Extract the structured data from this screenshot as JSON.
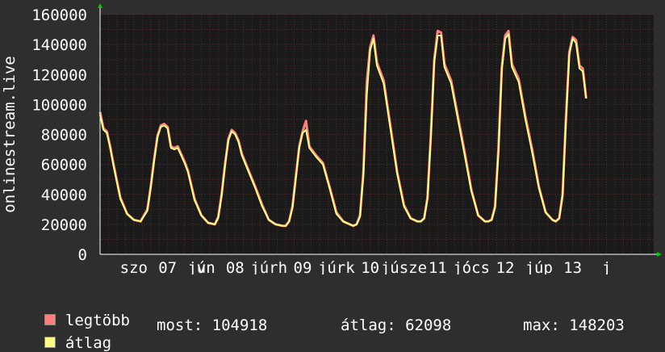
{
  "chart_data": {
    "type": "area",
    "ylabel": "onlinestream.live",
    "ylim": [
      0,
      160000
    ],
    "y_ticks": [
      {
        "value": 0,
        "label": "0"
      },
      {
        "value": 20000,
        "label": "20000"
      },
      {
        "value": 40000,
        "label": "40000"
      },
      {
        "value": 60000,
        "label": "60000"
      },
      {
        "value": 80000,
        "label": "80000"
      },
      {
        "value": 100000,
        "label": "100000"
      },
      {
        "value": 120000,
        "label": "120000"
      },
      {
        "value": 140000,
        "label": "140000"
      },
      {
        "value": 160000,
        "label": "160000"
      }
    ],
    "xlim": [
      0,
      8.2
    ],
    "x_ticks": [
      {
        "x": 0.5,
        "label": "szo"
      },
      {
        "x": 1.0,
        "label": "07"
      },
      {
        "x": 1.5,
        "label": "jún"
      },
      {
        "x": 1.5,
        "label": "v"
      },
      {
        "x": 2.0,
        "label": "08"
      },
      {
        "x": 2.5,
        "label": "júrh"
      },
      {
        "x": 3.0,
        "label": "09"
      },
      {
        "x": 3.5,
        "label": "júrk"
      },
      {
        "x": 4.0,
        "label": "10"
      },
      {
        "x": 4.5,
        "label": "júsze"
      },
      {
        "x": 5.0,
        "label": "11"
      },
      {
        "x": 5.5,
        "label": "jócs"
      },
      {
        "x": 6.0,
        "label": "12"
      },
      {
        "x": 6.5,
        "label": "júp"
      },
      {
        "x": 7.0,
        "label": "13"
      },
      {
        "x": 7.5,
        "label": "j"
      }
    ],
    "series": [
      {
        "name": "legtöbb",
        "color": "#ff7f7f",
        "x": [
          0.0,
          0.05,
          0.1,
          0.15,
          0.2,
          0.3,
          0.4,
          0.5,
          0.6,
          0.7,
          0.75,
          0.8,
          0.85,
          0.9,
          0.95,
          1.0,
          1.05,
          1.1,
          1.15,
          1.2,
          1.25,
          1.3,
          1.4,
          1.5,
          1.6,
          1.7,
          1.75,
          1.8,
          1.85,
          1.9,
          1.95,
          2.0,
          2.05,
          2.1,
          2.2,
          2.3,
          2.4,
          2.5,
          2.6,
          2.7,
          2.75,
          2.8,
          2.85,
          2.9,
          2.95,
          3.0,
          3.05,
          3.1,
          3.2,
          3.3,
          3.4,
          3.5,
          3.6,
          3.7,
          3.75,
          3.8,
          3.85,
          3.9,
          3.95,
          4.0,
          4.05,
          4.1,
          4.2,
          4.3,
          4.4,
          4.5,
          4.6,
          4.7,
          4.75,
          4.8,
          4.85,
          4.9,
          4.95,
          5.0,
          5.05,
          5.1,
          5.2,
          5.3,
          5.4,
          5.5,
          5.6,
          5.7,
          5.75,
          5.8,
          5.85,
          5.9,
          5.95,
          6.0,
          6.05,
          6.1,
          6.2,
          6.3,
          6.4,
          6.5,
          6.6,
          6.7,
          6.75,
          6.8,
          6.85,
          6.9,
          6.95,
          7.0,
          7.05,
          7.1,
          7.15,
          7.2
        ],
        "values": [
          95000,
          84000,
          82000,
          72000,
          60000,
          38000,
          27000,
          23000,
          22000,
          30000,
          45000,
          63000,
          79000,
          86000,
          87000,
          85000,
          72000,
          71000,
          72000,
          67000,
          62000,
          56000,
          37000,
          26000,
          21000,
          20000,
          25000,
          40000,
          60000,
          77000,
          83000,
          81000,
          76000,
          67000,
          56000,
          45000,
          33000,
          23000,
          20000,
          19000,
          19000,
          22000,
          32000,
          52000,
          72000,
          82000,
          89000,
          72000,
          66000,
          61000,
          45000,
          28000,
          22000,
          20000,
          19000,
          20000,
          26000,
          55000,
          115000,
          138000,
          146000,
          128000,
          116000,
          86000,
          55000,
          33000,
          24000,
          22000,
          22000,
          24000,
          38000,
          80000,
          130000,
          149000,
          148000,
          127000,
          116000,
          92000,
          68000,
          43000,
          26000,
          22000,
          22000,
          23000,
          32000,
          70000,
          125000,
          146000,
          149000,
          127000,
          117000,
          92000,
          70000,
          45000,
          28000,
          23000,
          22000,
          24000,
          40000,
          90000,
          135000,
          145000,
          143000,
          126000,
          124000,
          104000
        ]
      },
      {
        "name": "átlag",
        "color": "#ffff7f",
        "x": [
          0.0,
          0.05,
          0.1,
          0.15,
          0.2,
          0.3,
          0.4,
          0.5,
          0.6,
          0.7,
          0.75,
          0.8,
          0.85,
          0.9,
          0.95,
          1.0,
          1.05,
          1.1,
          1.15,
          1.2,
          1.25,
          1.3,
          1.4,
          1.5,
          1.6,
          1.7,
          1.75,
          1.8,
          1.85,
          1.9,
          1.95,
          2.0,
          2.05,
          2.1,
          2.2,
          2.3,
          2.4,
          2.5,
          2.6,
          2.7,
          2.75,
          2.8,
          2.85,
          2.9,
          2.95,
          3.0,
          3.05,
          3.1,
          3.2,
          3.3,
          3.4,
          3.5,
          3.6,
          3.7,
          3.75,
          3.8,
          3.85,
          3.9,
          3.95,
          4.0,
          4.05,
          4.1,
          4.2,
          4.3,
          4.4,
          4.5,
          4.6,
          4.7,
          4.75,
          4.8,
          4.85,
          4.9,
          4.95,
          5.0,
          5.05,
          5.1,
          5.2,
          5.3,
          5.4,
          5.5,
          5.6,
          5.7,
          5.75,
          5.8,
          5.85,
          5.9,
          5.95,
          6.0,
          6.05,
          6.1,
          6.2,
          6.3,
          6.4,
          6.5,
          6.6,
          6.7,
          6.75,
          6.8,
          6.85,
          6.9,
          6.95,
          7.0,
          7.05,
          7.1,
          7.15,
          7.2
        ],
        "values": [
          93000,
          83000,
          81000,
          71000,
          59000,
          37000,
          27000,
          23000,
          22000,
          29000,
          44000,
          62000,
          78000,
          85000,
          86000,
          84000,
          71000,
          70000,
          71000,
          66000,
          61000,
          55000,
          36000,
          26000,
          21000,
          20000,
          24000,
          39000,
          59000,
          76000,
          82000,
          80000,
          75000,
          66000,
          55000,
          44000,
          32000,
          23000,
          20000,
          19000,
          19000,
          22000,
          31000,
          51000,
          71000,
          81000,
          83000,
          71000,
          65000,
          60000,
          44000,
          27000,
          22000,
          20000,
          19000,
          20000,
          25000,
          53000,
          106000,
          136000,
          144000,
          126000,
          114000,
          84000,
          54000,
          32000,
          24000,
          22000,
          22000,
          24000,
          37000,
          78000,
          128000,
          146000,
          146000,
          125000,
          114000,
          90000,
          66000,
          42000,
          26000,
          22000,
          22000,
          23000,
          31000,
          68000,
          123000,
          144000,
          147000,
          125000,
          115000,
          90000,
          68000,
          44000,
          28000,
          23000,
          22000,
          24000,
          39000,
          88000,
          133000,
          144000,
          141000,
          124000,
          122000,
          104000
        ]
      }
    ]
  },
  "legend": {
    "max_label": "legtöbb",
    "avg_label": "átlag",
    "stats": {
      "now": "most: 104918",
      "avg": "átlag: 62098",
      "max": "max: 148203"
    }
  },
  "colors": {
    "background": "#2e2e2e",
    "plot_background": "#1a1a1a",
    "grid": "#5a2a2a",
    "axis": "#ffffff",
    "arrow": "#00cc00"
  }
}
